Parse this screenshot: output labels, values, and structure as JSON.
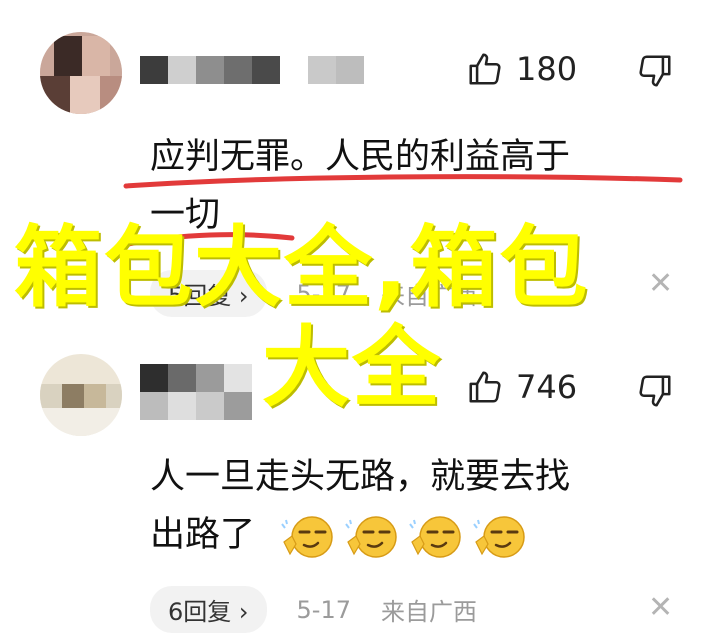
{
  "comments": [
    {
      "likes": "180",
      "text_line1": "应判无罪。人民的利益高于",
      "text_line2": "一切",
      "reply_count": "5回复",
      "date": "5-17",
      "location": "来自广西"
    },
    {
      "likes": "746",
      "text_line1": "人一旦走头无路，就要去找",
      "text_line2": "出路了",
      "reply_count": "6回复",
      "date": "5-17",
      "location": "来自广西"
    }
  ],
  "watermark": {
    "line1": "箱包大全,箱包",
    "line2": "大全"
  },
  "colors": {
    "underline": "#e23a3a",
    "watermark": "#ffff00",
    "meta": "#9b9b9b"
  },
  "icons": [
    "thumbs-up-icon",
    "thumbs-down-icon",
    "close-icon",
    "chevron-right-icon",
    "smug-emoji-icon"
  ]
}
